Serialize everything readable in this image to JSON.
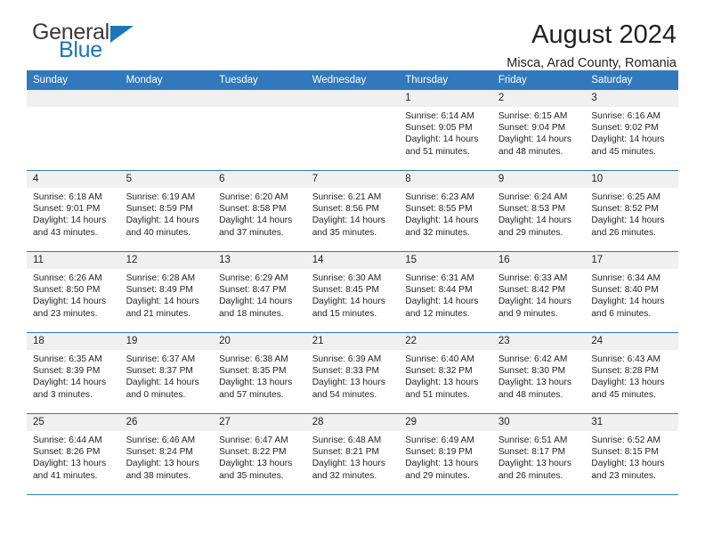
{
  "brand": {
    "name_part1": "General",
    "name_part2": "Blue",
    "accent_color": "#1b75bb",
    "triangle_icon": "logo-triangle-icon"
  },
  "header": {
    "title": "August 2024",
    "subtitle": "Misca, Arad County, Romania"
  },
  "theme": {
    "header_blue": "#3179bc",
    "daynum_gray": "#f0f0f0",
    "text": "#231f20"
  },
  "weekday_headers": [
    "Sunday",
    "Monday",
    "Tuesday",
    "Wednesday",
    "Thursday",
    "Friday",
    "Saturday"
  ],
  "weeks": [
    [
      {
        "day": "",
        "blank": true
      },
      {
        "day": "",
        "blank": true
      },
      {
        "day": "",
        "blank": true
      },
      {
        "day": "",
        "blank": true
      },
      {
        "day": "1",
        "sunrise": "Sunrise: 6:14 AM",
        "sunset": "Sunset: 9:05 PM",
        "daylight1": "Daylight: 14 hours",
        "daylight2": "and 51 minutes."
      },
      {
        "day": "2",
        "sunrise": "Sunrise: 6:15 AM",
        "sunset": "Sunset: 9:04 PM",
        "daylight1": "Daylight: 14 hours",
        "daylight2": "and 48 minutes."
      },
      {
        "day": "3",
        "sunrise": "Sunrise: 6:16 AM",
        "sunset": "Sunset: 9:02 PM",
        "daylight1": "Daylight: 14 hours",
        "daylight2": "and 45 minutes."
      }
    ],
    [
      {
        "day": "4",
        "sunrise": "Sunrise: 6:18 AM",
        "sunset": "Sunset: 9:01 PM",
        "daylight1": "Daylight: 14 hours",
        "daylight2": "and 43 minutes."
      },
      {
        "day": "5",
        "sunrise": "Sunrise: 6:19 AM",
        "sunset": "Sunset: 8:59 PM",
        "daylight1": "Daylight: 14 hours",
        "daylight2": "and 40 minutes."
      },
      {
        "day": "6",
        "sunrise": "Sunrise: 6:20 AM",
        "sunset": "Sunset: 8:58 PM",
        "daylight1": "Daylight: 14 hours",
        "daylight2": "and 37 minutes."
      },
      {
        "day": "7",
        "sunrise": "Sunrise: 6:21 AM",
        "sunset": "Sunset: 8:56 PM",
        "daylight1": "Daylight: 14 hours",
        "daylight2": "and 35 minutes."
      },
      {
        "day": "8",
        "sunrise": "Sunrise: 6:23 AM",
        "sunset": "Sunset: 8:55 PM",
        "daylight1": "Daylight: 14 hours",
        "daylight2": "and 32 minutes."
      },
      {
        "day": "9",
        "sunrise": "Sunrise: 6:24 AM",
        "sunset": "Sunset: 8:53 PM",
        "daylight1": "Daylight: 14 hours",
        "daylight2": "and 29 minutes."
      },
      {
        "day": "10",
        "sunrise": "Sunrise: 6:25 AM",
        "sunset": "Sunset: 8:52 PM",
        "daylight1": "Daylight: 14 hours",
        "daylight2": "and 26 minutes."
      }
    ],
    [
      {
        "day": "11",
        "sunrise": "Sunrise: 6:26 AM",
        "sunset": "Sunset: 8:50 PM",
        "daylight1": "Daylight: 14 hours",
        "daylight2": "and 23 minutes."
      },
      {
        "day": "12",
        "sunrise": "Sunrise: 6:28 AM",
        "sunset": "Sunset: 8:49 PM",
        "daylight1": "Daylight: 14 hours",
        "daylight2": "and 21 minutes."
      },
      {
        "day": "13",
        "sunrise": "Sunrise: 6:29 AM",
        "sunset": "Sunset: 8:47 PM",
        "daylight1": "Daylight: 14 hours",
        "daylight2": "and 18 minutes."
      },
      {
        "day": "14",
        "sunrise": "Sunrise: 6:30 AM",
        "sunset": "Sunset: 8:45 PM",
        "daylight1": "Daylight: 14 hours",
        "daylight2": "and 15 minutes."
      },
      {
        "day": "15",
        "sunrise": "Sunrise: 6:31 AM",
        "sunset": "Sunset: 8:44 PM",
        "daylight1": "Daylight: 14 hours",
        "daylight2": "and 12 minutes."
      },
      {
        "day": "16",
        "sunrise": "Sunrise: 6:33 AM",
        "sunset": "Sunset: 8:42 PM",
        "daylight1": "Daylight: 14 hours",
        "daylight2": "and 9 minutes."
      },
      {
        "day": "17",
        "sunrise": "Sunrise: 6:34 AM",
        "sunset": "Sunset: 8:40 PM",
        "daylight1": "Daylight: 14 hours",
        "daylight2": "and 6 minutes."
      }
    ],
    [
      {
        "day": "18",
        "sunrise": "Sunrise: 6:35 AM",
        "sunset": "Sunset: 8:39 PM",
        "daylight1": "Daylight: 14 hours",
        "daylight2": "and 3 minutes."
      },
      {
        "day": "19",
        "sunrise": "Sunrise: 6:37 AM",
        "sunset": "Sunset: 8:37 PM",
        "daylight1": "Daylight: 14 hours",
        "daylight2": "and 0 minutes."
      },
      {
        "day": "20",
        "sunrise": "Sunrise: 6:38 AM",
        "sunset": "Sunset: 8:35 PM",
        "daylight1": "Daylight: 13 hours",
        "daylight2": "and 57 minutes."
      },
      {
        "day": "21",
        "sunrise": "Sunrise: 6:39 AM",
        "sunset": "Sunset: 8:33 PM",
        "daylight1": "Daylight: 13 hours",
        "daylight2": "and 54 minutes."
      },
      {
        "day": "22",
        "sunrise": "Sunrise: 6:40 AM",
        "sunset": "Sunset: 8:32 PM",
        "daylight1": "Daylight: 13 hours",
        "daylight2": "and 51 minutes."
      },
      {
        "day": "23",
        "sunrise": "Sunrise: 6:42 AM",
        "sunset": "Sunset: 8:30 PM",
        "daylight1": "Daylight: 13 hours",
        "daylight2": "and 48 minutes."
      },
      {
        "day": "24",
        "sunrise": "Sunrise: 6:43 AM",
        "sunset": "Sunset: 8:28 PM",
        "daylight1": "Daylight: 13 hours",
        "daylight2": "and 45 minutes."
      }
    ],
    [
      {
        "day": "25",
        "sunrise": "Sunrise: 6:44 AM",
        "sunset": "Sunset: 8:26 PM",
        "daylight1": "Daylight: 13 hours",
        "daylight2": "and 41 minutes."
      },
      {
        "day": "26",
        "sunrise": "Sunrise: 6:46 AM",
        "sunset": "Sunset: 8:24 PM",
        "daylight1": "Daylight: 13 hours",
        "daylight2": "and 38 minutes."
      },
      {
        "day": "27",
        "sunrise": "Sunrise: 6:47 AM",
        "sunset": "Sunset: 8:22 PM",
        "daylight1": "Daylight: 13 hours",
        "daylight2": "and 35 minutes."
      },
      {
        "day": "28",
        "sunrise": "Sunrise: 6:48 AM",
        "sunset": "Sunset: 8:21 PM",
        "daylight1": "Daylight: 13 hours",
        "daylight2": "and 32 minutes."
      },
      {
        "day": "29",
        "sunrise": "Sunrise: 6:49 AM",
        "sunset": "Sunset: 8:19 PM",
        "daylight1": "Daylight: 13 hours",
        "daylight2": "and 29 minutes."
      },
      {
        "day": "30",
        "sunrise": "Sunrise: 6:51 AM",
        "sunset": "Sunset: 8:17 PM",
        "daylight1": "Daylight: 13 hours",
        "daylight2": "and 26 minutes."
      },
      {
        "day": "31",
        "sunrise": "Sunrise: 6:52 AM",
        "sunset": "Sunset: 8:15 PM",
        "daylight1": "Daylight: 13 hours",
        "daylight2": "and 23 minutes."
      }
    ]
  ]
}
